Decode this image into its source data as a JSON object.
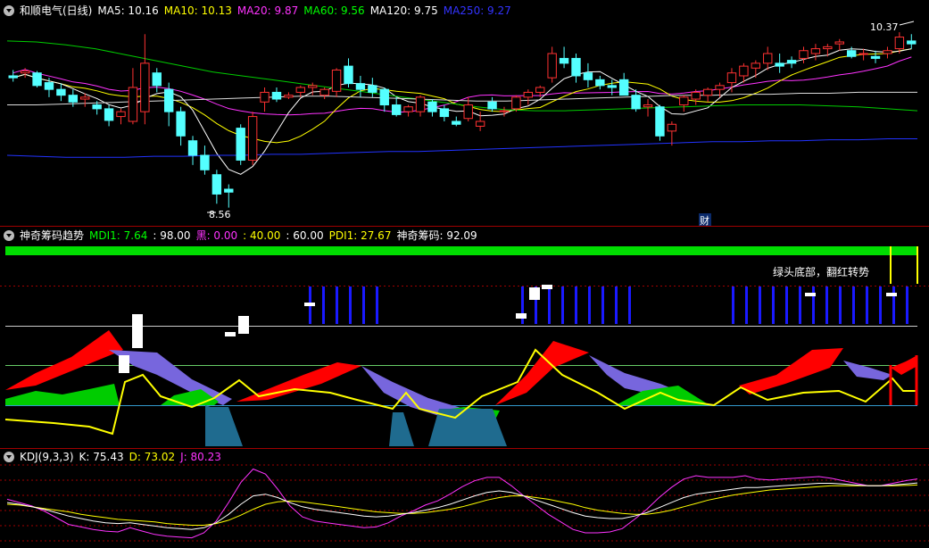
{
  "panel1": {
    "header": [
      {
        "text": "和顺电气(日线)",
        "color": "#ffffff"
      },
      {
        "text": "MA5: 10.16",
        "color": "#ffffff"
      },
      {
        "text": "MA10: 10.13",
        "color": "#ffff00"
      },
      {
        "text": "MA20: 9.87",
        "color": "#ff33ff"
      },
      {
        "text": "MA60: 9.56",
        "color": "#00ff00"
      },
      {
        "text": "MA120: 9.75",
        "color": "#ffffff"
      },
      {
        "text": "MA250: 9.27",
        "color": "#3333ff"
      }
    ],
    "low_label": "8.56",
    "high_label": "10.37",
    "cai_label": "财"
  },
  "panel2": {
    "header": [
      {
        "text": "神奇筹码趋势",
        "color": "#ffffff"
      },
      {
        "text": "MDI1: 7.64",
        "color": "#00ff00"
      },
      {
        "text": ": 98.00",
        "color": "#ffffff"
      },
      {
        "text": "黑: 0.00",
        "color": "#ff33ff"
      },
      {
        "text": ": 40.00",
        "color": "#ffff00"
      },
      {
        "text": ": 60.00",
        "color": "#ffffff"
      },
      {
        "text": "PDI1: 27.67",
        "color": "#ffff00"
      },
      {
        "text": "神奇筹码: 92.09",
        "color": "#ffffff"
      }
    ],
    "annotation": "绿头底部，翻红转势"
  },
  "panel3": {
    "header": [
      {
        "text": "KDJ(9,3,3)",
        "color": "#ffffff"
      },
      {
        "text": "K: 75.43",
        "color": "#ffffff"
      },
      {
        "text": "D: 73.02",
        "color": "#ffff00"
      },
      {
        "text": "J: 80.23",
        "color": "#ff33ff"
      }
    ]
  },
  "chart_data": [
    {
      "type": "candlestick",
      "series": [
        {
          "name": "MA5",
          "color": "#ffffff",
          "values": [
            10.16
          ]
        },
        {
          "name": "MA10",
          "color": "#ffff00",
          "values": [
            10.13
          ]
        },
        {
          "name": "MA20",
          "color": "#ff33ff",
          "values": [
            9.87
          ]
        },
        {
          "name": "MA60",
          "color": "#00ff00",
          "values": [
            9.56
          ]
        },
        {
          "name": "MA120",
          "color": "#ffffff",
          "values": [
            9.75
          ]
        },
        {
          "name": "MA250",
          "color": "#3333ff",
          "values": [
            9.27
          ]
        }
      ],
      "ylim": [
        8.4,
        10.5
      ],
      "candles": [
        [
          9.92,
          9.98,
          9.86,
          9.9
        ],
        [
          9.95,
          10.0,
          9.9,
          9.97
        ],
        [
          9.95,
          9.97,
          9.8,
          9.82
        ],
        [
          9.85,
          9.9,
          9.7,
          9.78
        ],
        [
          9.78,
          9.84,
          9.66,
          9.72
        ],
        [
          9.72,
          9.78,
          9.6,
          9.65
        ],
        [
          9.68,
          9.74,
          9.6,
          9.7
        ],
        [
          9.62,
          9.66,
          9.52,
          9.58
        ],
        [
          9.58,
          9.62,
          9.4,
          9.46
        ],
        [
          9.5,
          9.58,
          9.42,
          9.55
        ],
        [
          9.45,
          10.0,
          9.42,
          9.8
        ],
        [
          9.55,
          10.35,
          9.42,
          10.05
        ],
        [
          9.95,
          10.0,
          9.75,
          9.82
        ],
        [
          9.78,
          9.85,
          9.4,
          9.55
        ],
        [
          9.55,
          9.6,
          9.2,
          9.3
        ],
        [
          9.25,
          9.3,
          9.0,
          9.1
        ],
        [
          9.1,
          9.2,
          8.9,
          8.95
        ],
        [
          8.9,
          8.95,
          8.6,
          8.7
        ],
        [
          8.75,
          8.8,
          8.56,
          8.72
        ],
        [
          9.38,
          9.42,
          9.0,
          9.05
        ],
        [
          9.05,
          9.55,
          9.0,
          9.5
        ],
        [
          9.65,
          9.8,
          9.55,
          9.75
        ],
        [
          9.75,
          9.8,
          9.65,
          9.68
        ],
        [
          9.7,
          9.75,
          9.68,
          9.72
        ],
        [
          9.75,
          9.82,
          9.7,
          9.8
        ],
        [
          9.8,
          9.85,
          9.72,
          9.82
        ],
        [
          9.72,
          9.8,
          9.68,
          9.78
        ],
        [
          9.76,
          10.0,
          9.7,
          9.98
        ],
        [
          10.02,
          10.1,
          9.8,
          9.84
        ],
        [
          9.84,
          9.92,
          9.7,
          9.78
        ],
        [
          9.82,
          9.9,
          9.7,
          9.75
        ],
        [
          9.78,
          9.8,
          9.55,
          9.62
        ],
        [
          9.62,
          9.7,
          9.5,
          9.52
        ],
        [
          9.55,
          9.62,
          9.5,
          9.6
        ],
        [
          9.55,
          9.72,
          9.5,
          9.7
        ],
        [
          9.65,
          9.68,
          9.5,
          9.55
        ],
        [
          9.58,
          9.62,
          9.45,
          9.5
        ],
        [
          9.45,
          9.5,
          9.4,
          9.42
        ],
        [
          9.48,
          9.7,
          9.45,
          9.62
        ],
        [
          9.4,
          9.55,
          9.35,
          9.45
        ],
        [
          9.65,
          9.7,
          9.55,
          9.58
        ],
        [
          9.55,
          9.6,
          9.5,
          9.56
        ],
        [
          9.58,
          9.72,
          9.55,
          9.7
        ],
        [
          9.7,
          9.78,
          9.62,
          9.75
        ],
        [
          9.75,
          9.82,
          9.7,
          9.8
        ],
        [
          9.9,
          10.22,
          9.85,
          10.15
        ],
        [
          10.1,
          10.22,
          10.0,
          10.05
        ],
        [
          10.1,
          10.15,
          9.85,
          9.92
        ],
        [
          9.95,
          10.05,
          9.8,
          9.88
        ],
        [
          9.88,
          9.92,
          9.78,
          9.82
        ],
        [
          9.82,
          9.88,
          9.72,
          9.8
        ],
        [
          9.88,
          9.95,
          9.72,
          9.72
        ],
        [
          9.72,
          9.78,
          9.55,
          9.58
        ],
        [
          9.6,
          9.68,
          9.5,
          9.62
        ],
        [
          9.6,
          9.62,
          9.25,
          9.3
        ],
        [
          9.35,
          9.45,
          9.2,
          9.42
        ],
        [
          9.62,
          9.72,
          9.55,
          9.7
        ],
        [
          9.68,
          9.78,
          9.62,
          9.75
        ],
        [
          9.72,
          9.8,
          9.65,
          9.78
        ],
        [
          9.78,
          9.85,
          9.7,
          9.82
        ],
        [
          9.85,
          10.0,
          9.75,
          9.95
        ],
        [
          9.92,
          10.05,
          9.85,
          10.02
        ],
        [
          10.0,
          10.08,
          9.9,
          10.05
        ],
        [
          10.05,
          10.22,
          9.98,
          10.15
        ],
        [
          10.05,
          10.15,
          9.95,
          10.02
        ],
        [
          10.08,
          10.12,
          10.0,
          10.05
        ],
        [
          10.1,
          10.22,
          10.05,
          10.18
        ],
        [
          10.15,
          10.25,
          10.08,
          10.2
        ],
        [
          10.2,
          10.25,
          10.12,
          10.22
        ],
        [
          10.25,
          10.3,
          10.18,
          10.27
        ],
        [
          10.18,
          10.22,
          10.1,
          10.12
        ],
        [
          10.15,
          10.2,
          10.08,
          10.15
        ],
        [
          10.12,
          10.18,
          10.05,
          10.1
        ],
        [
          10.15,
          10.22,
          10.1,
          10.18
        ],
        [
          10.2,
          10.37,
          10.15,
          10.32
        ],
        [
          10.28,
          10.35,
          10.2,
          10.25
        ]
      ]
    },
    {
      "type": "indicator",
      "series": [
        {
          "name": "MDI1",
          "color": "#00ff00",
          "values": [
            7.64
          ]
        },
        {
          "name": "黑",
          "color": "#ff33ff",
          "values": [
            0.0
          ]
        },
        {
          "name": "PDI1",
          "color": "#ffff00",
          "values": [
            27.67
          ]
        },
        {
          "name": "神奇筹码",
          "color": "#ffffff",
          "values": [
            92.09
          ]
        }
      ],
      "levels": [
        98.0,
        40.0,
        60.0
      ]
    },
    {
      "type": "line",
      "series": [
        {
          "name": "K",
          "color": "#ffffff",
          "values": [
            52,
            50,
            47,
            44,
            40,
            36,
            33,
            30,
            28,
            27,
            28,
            26,
            24,
            22,
            21,
            20,
            22,
            28,
            38,
            50,
            60,
            62,
            58,
            52,
            47,
            44,
            42,
            40,
            38,
            36,
            35,
            36,
            38,
            40,
            43,
            46,
            50,
            55,
            60,
            64,
            66,
            64,
            60,
            55,
            50,
            45,
            40,
            36,
            34,
            33,
            33,
            36,
            40,
            46,
            52,
            58,
            62,
            64,
            66,
            68,
            70,
            70,
            71,
            72,
            73,
            74,
            75,
            75,
            74,
            73,
            72,
            72,
            73,
            74,
            75.43
          ]
        },
        {
          "name": "D",
          "color": "#ffff00",
          "values": [
            50,
            49,
            47,
            45,
            43,
            41,
            38,
            36,
            34,
            32,
            31,
            30,
            29,
            27,
            26,
            25,
            25,
            27,
            31,
            37,
            44,
            50,
            53,
            54,
            53,
            51,
            49,
            47,
            45,
            43,
            41,
            40,
            39,
            39,
            40,
            42,
            44,
            47,
            51,
            55,
            58,
            60,
            60,
            58,
            56,
            53,
            50,
            46,
            43,
            41,
            39,
            38,
            38,
            40,
            43,
            47,
            51,
            55,
            58,
            61,
            63,
            65,
            67,
            68,
            69,
            70,
            71,
            72,
            72,
            72,
            72,
            72,
            72,
            72.5,
            73.02
          ]
        },
        {
          "name": "J",
          "color": "#ff33ff",
          "values": [
            56,
            52,
            48,
            42,
            34,
            26,
            23,
            20,
            18,
            17,
            22,
            18,
            14,
            12,
            11,
            10,
            16,
            30,
            52,
            76,
            92,
            86,
            68,
            48,
            35,
            30,
            28,
            26,
            24,
            22,
            23,
            28,
            36,
            42,
            49,
            54,
            62,
            71,
            78,
            82,
            82,
            72,
            60,
            49,
            38,
            29,
            20,
            16,
            16,
            17,
            21,
            32,
            44,
            58,
            70,
            80,
            84,
            82,
            82,
            82,
            84,
            80,
            79,
            80,
            81,
            82,
            83,
            81,
            78,
            75,
            72,
            72,
            75,
            78,
            80.23
          ]
        }
      ],
      "ylim": [
        0,
        100
      ]
    }
  ]
}
